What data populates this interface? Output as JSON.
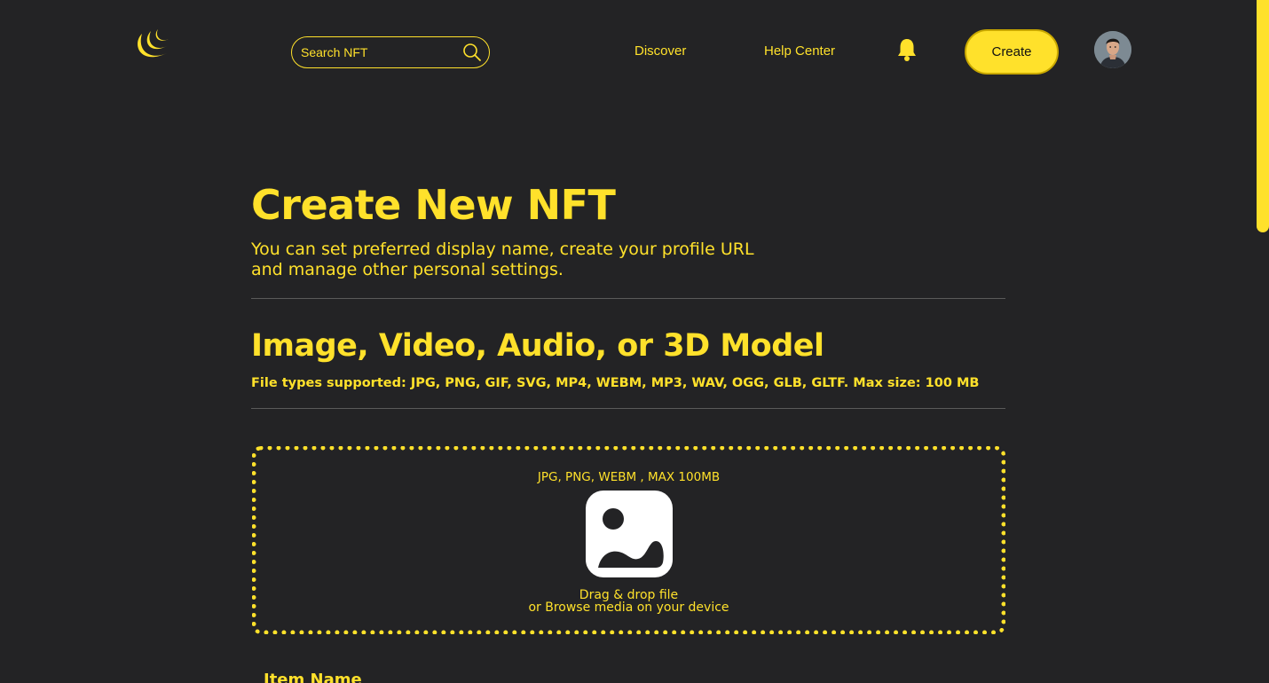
{
  "header": {
    "search": {
      "placeholder": "Search NFT"
    },
    "nav": {
      "discover": "Discover",
      "help_center": "Help Center"
    },
    "create_label": "Create",
    "icons": {
      "logo": "crescent-logo",
      "search": "search-icon",
      "notifications": "bell-icon"
    }
  },
  "main": {
    "title": "Create New NFT",
    "subtitle_line1": "You can set preferred display name, create your profile URL",
    "subtitle_line2": "and manage other personal settings.",
    "media_section": {
      "title": "Image, Video, Audio, or 3D Model",
      "file_types": "File types supported: JPG, PNG, GIF, SVG, MP4, WEBM, MP3, WAV, OGG, GLB, GLTF. Max size: 100 MB"
    },
    "dropzone": {
      "formats": "JPG, PNG, WEBM , MAX 100MB",
      "line1": "Drag & drop file",
      "line2": "or Browse media on your device",
      "icon": "image-icon"
    },
    "item_name_label": "Item Name"
  },
  "colors": {
    "accent": "#FFE12B",
    "background": "#232325",
    "divider": "#5A5A5A"
  }
}
